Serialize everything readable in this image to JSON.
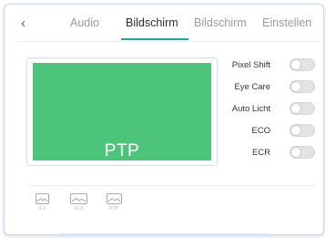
{
  "header": {
    "back_icon": "chevron-left-icon",
    "back_glyph": "‹",
    "tabs": [
      {
        "label": "Audio",
        "active": false
      },
      {
        "label": "Bildschirm",
        "active": true
      },
      {
        "label": "Bildschirm",
        "active": false
      },
      {
        "label": "Einstellen",
        "active": false
      }
    ]
  },
  "preview": {
    "label": "PTP",
    "screen_color": "#4cc47a"
  },
  "settings": [
    {
      "label": "Pixel Shift",
      "enabled": false
    },
    {
      "label": "Eye Care",
      "enabled": false
    },
    {
      "label": "Auto Licht",
      "enabled": false
    },
    {
      "label": "ECO",
      "enabled": false
    },
    {
      "label": "ECR",
      "enabled": false
    }
  ],
  "aspect_ratios": [
    {
      "label": "4:3",
      "icon": "picture-icon"
    },
    {
      "label": "16:9",
      "icon": "picture-icon"
    },
    {
      "label": "PTP",
      "icon": "picture-icon"
    }
  ],
  "colors": {
    "accent": "#18a9a0",
    "screen": "#4cc47a"
  }
}
